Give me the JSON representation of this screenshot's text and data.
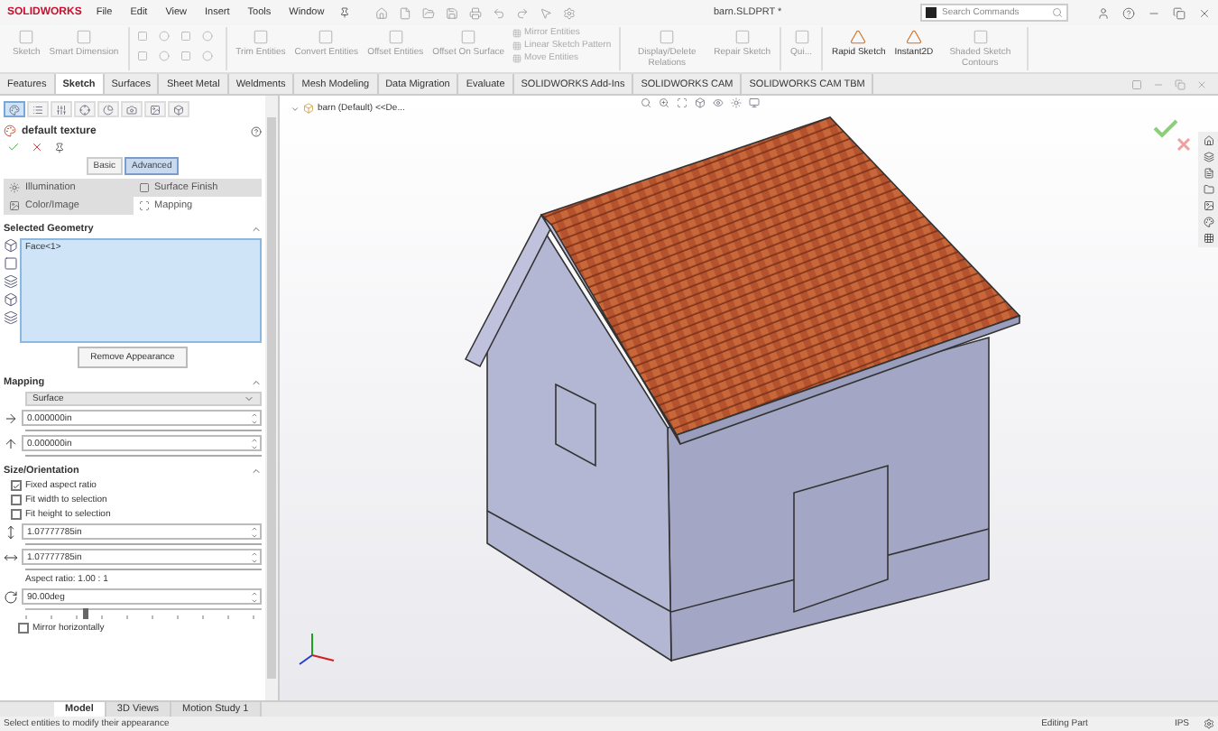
{
  "title_bar": {
    "logo": "SOLIDWORKS",
    "menu": [
      "File",
      "Edit",
      "View",
      "Insert",
      "Tools",
      "Window"
    ],
    "document_title": "barn.SLDPRT *",
    "search": {
      "placeholder": "Search Commands"
    }
  },
  "ribbon": [
    {
      "items": [
        {
          "kind": "large",
          "label": "Sketch",
          "disabled": true
        },
        {
          "kind": "large",
          "label": "Smart Dimension",
          "disabled": true
        }
      ]
    },
    {
      "items": [
        {
          "kind": "large",
          "label": "Trim Entities",
          "disabled": true
        },
        {
          "kind": "large",
          "label": "Convert Entities",
          "disabled": true
        },
        {
          "kind": "large",
          "label": "Offset Entities",
          "disabled": true
        },
        {
          "kind": "large",
          "label": "Offset On Surface",
          "disabled": true
        },
        {
          "kind": "small",
          "label": "Mirror Entities",
          "disabled": true
        },
        {
          "kind": "small",
          "label": "Linear Sketch Pattern",
          "disabled": true
        },
        {
          "kind": "small",
          "label": "Move Entities",
          "disabled": true
        }
      ]
    },
    {
      "items": [
        {
          "kind": "large",
          "label": "Display/Delete Relations",
          "disabled": true
        },
        {
          "kind": "large",
          "label": "Repair Sketch",
          "disabled": true
        }
      ]
    },
    {
      "items": [
        {
          "kind": "large",
          "label": "Qui...",
          "disabled": true
        }
      ]
    },
    {
      "items": [
        {
          "kind": "large",
          "label": "Rapid Sketch",
          "disabled": false
        },
        {
          "kind": "large",
          "label": "Instant2D",
          "disabled": false
        },
        {
          "kind": "large",
          "label": "Shaded Sketch Contours",
          "disabled": true
        }
      ]
    }
  ],
  "command_tabs": [
    {
      "label": "Features",
      "selected": false
    },
    {
      "label": "Sketch",
      "selected": true
    },
    {
      "label": "Surfaces",
      "selected": false
    },
    {
      "label": "Sheet Metal",
      "selected": false
    },
    {
      "label": "Weldments",
      "selected": false
    },
    {
      "label": "Mesh Modeling",
      "selected": false
    },
    {
      "label": "Data Migration",
      "selected": false
    },
    {
      "label": "Evaluate",
      "selected": false
    },
    {
      "label": "SOLIDWORKS Add-Ins",
      "selected": false
    },
    {
      "label": "SOLIDWORKS CAM",
      "selected": false
    },
    {
      "label": "SOLIDWORKS CAM TBM",
      "selected": false
    }
  ],
  "property_manager": {
    "panel_tabs": [
      {
        "selected": true
      },
      {
        "selected": false
      },
      {
        "selected": false
      },
      {
        "selected": false
      },
      {
        "selected": false
      },
      {
        "selected": false
      },
      {
        "selected": false
      },
      {
        "selected": false
      }
    ],
    "title": "default texture",
    "mode_buttons": [
      {
        "label": "Basic",
        "selected": false
      },
      {
        "label": "Advanced",
        "selected": true
      }
    ],
    "tabs": [
      {
        "label": "Illumination",
        "selected": false
      },
      {
        "label": "Surface Finish",
        "selected": false
      },
      {
        "label": "Color/Image",
        "selected": false
      },
      {
        "label": "Mapping",
        "selected": true
      }
    ],
    "selected_geometry": {
      "title": "Selected Geometry",
      "items": [
        "Face<1>"
      ],
      "button": "Remove Appearance"
    },
    "mapping": {
      "title": "Mapping",
      "type": "Surface",
      "offsets": [
        {
          "kind": "horizontal",
          "value": "0.000000in"
        },
        {
          "kind": "vertical",
          "value": "0.000000in"
        }
      ]
    },
    "size_orientation": {
      "title": "Size/Orientation",
      "options": [
        {
          "label": "Fixed aspect ratio",
          "checked": true
        },
        {
          "label": "Fit width to selection",
          "checked": false
        },
        {
          "label": "Fit height to selection",
          "checked": false
        }
      ],
      "sizes": [
        {
          "kind": "height",
          "value": "1.07777785in"
        },
        {
          "kind": "width",
          "value": "1.07777785in"
        }
      ],
      "aspect_ratio": "Aspect ratio: 1.00 : 1",
      "rotation": {
        "value": "90.00deg",
        "level": 0.25
      },
      "mirror": {
        "label": "Mirror horizontally",
        "checked": false
      }
    }
  },
  "viewport": {
    "tree_label": "barn (Default) <<De..."
  },
  "bottom_tabs": [
    {
      "label": "Model",
      "selected": true
    },
    {
      "label": "3D Views",
      "selected": false
    },
    {
      "label": "Motion Study 1",
      "selected": false
    }
  ],
  "status_bar": {
    "message": "Select entities to modify their appearance",
    "mode": "Editing Part",
    "units": "IPS"
  }
}
